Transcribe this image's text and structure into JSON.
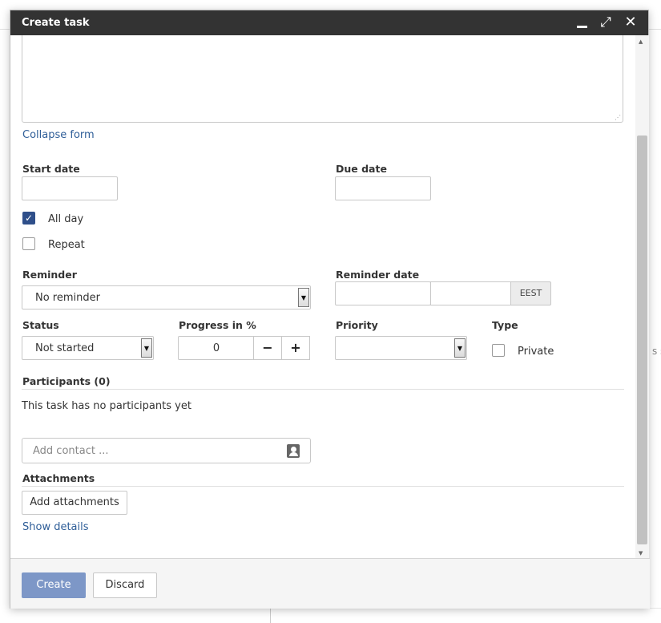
{
  "dialog": {
    "title": "Create task",
    "window_controls": {
      "minimize_icon": "minimize-icon",
      "maximize_icon": "expand-icon",
      "close_icon": "close-icon"
    }
  },
  "form": {
    "collapse_link": "Collapse form",
    "start_date": {
      "label": "Start date",
      "value": ""
    },
    "due_date": {
      "label": "Due date",
      "value": ""
    },
    "all_day": {
      "label": "All day",
      "checked": true
    },
    "repeat": {
      "label": "Repeat",
      "checked": false
    },
    "reminder": {
      "label": "Reminder",
      "value": "No reminder"
    },
    "reminder_date": {
      "label": "Reminder date",
      "date": "",
      "time": "",
      "timezone": "EEST"
    },
    "status": {
      "label": "Status",
      "value": "Not started"
    },
    "progress": {
      "label": "Progress in %",
      "value": "0",
      "decrement": "−",
      "increment": "+"
    },
    "priority": {
      "label": "Priority",
      "value": ""
    },
    "type": {
      "label": "Type",
      "private_label": "Private",
      "private_checked": false
    },
    "participants": {
      "heading": "Participants (0)",
      "empty_text": "This task has no participants yet",
      "add_placeholder": "Add contact ..."
    },
    "attachments": {
      "heading": "Attachments",
      "add_button": "Add attachments",
      "details_link": "Show details"
    }
  },
  "footer": {
    "create_label": "Create",
    "discard_label": "Discard"
  },
  "background": {
    "partial_text": "s so"
  },
  "colors": {
    "titlebar": "#333333",
    "primary_button": "#7d97c7",
    "link": "#2f5e98",
    "checkbox_checked": "#2f4f8a"
  }
}
